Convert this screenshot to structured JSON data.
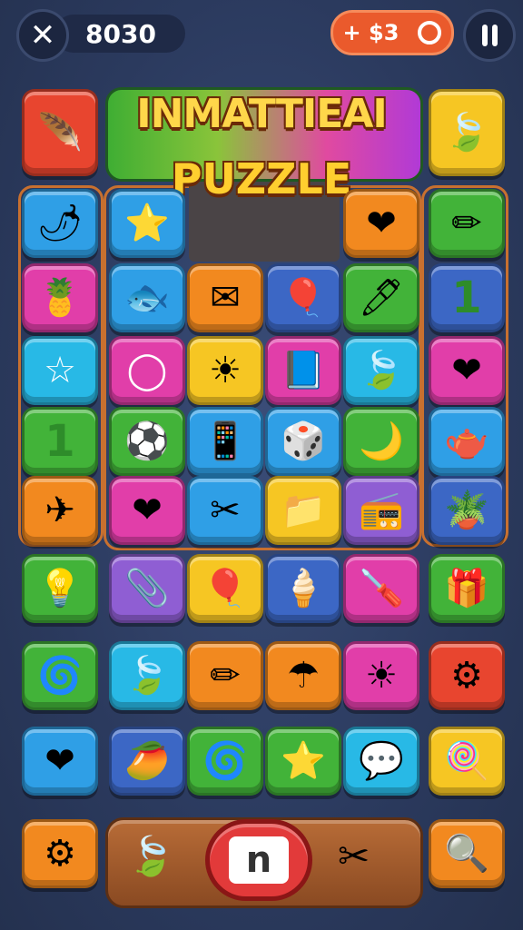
{
  "topbar": {
    "close_icon": "✕",
    "score": "8030",
    "coins_label": "+ $3",
    "coin_icon": "ring-icon",
    "pause_icon": "pause-icon"
  },
  "title": {
    "line1": "INMATTIEAI",
    "line2": "PUZZLE"
  },
  "colors": {
    "red": "#e8452f",
    "orange": "#f2891f",
    "yellow": "#f6c623",
    "green": "#42b339",
    "blue": "#2f9fe6",
    "navy": "#3c67c5",
    "pink": "#e13ea9",
    "purple": "#8f5ed3",
    "cyan": "#28b9e6"
  },
  "tiles": [
    {
      "c": "red",
      "i": "🪶"
    },
    {
      "c": "yellow",
      "i": "🍃"
    },
    {
      "c": "blue",
      "i": "🌶"
    },
    {
      "c": "blue",
      "i": "⭐"
    },
    {
      "c": "orange",
      "i": "❤"
    },
    {
      "c": "green",
      "i": "✏"
    },
    {
      "c": "pink",
      "i": "🍍"
    },
    {
      "c": "blue",
      "i": "🐟"
    },
    {
      "c": "orange",
      "i": "✉"
    },
    {
      "c": "navy",
      "i": "🎈"
    },
    {
      "c": "green",
      "i": "🖊"
    },
    {
      "c": "navy",
      "i": "1"
    },
    {
      "c": "cyan",
      "i": "☆"
    },
    {
      "c": "pink",
      "i": "◯"
    },
    {
      "c": "yellow",
      "i": "☀"
    },
    {
      "c": "pink",
      "i": "📘"
    },
    {
      "c": "cyan",
      "i": "🍃"
    },
    {
      "c": "pink",
      "i": "❤"
    },
    {
      "c": "green",
      "i": "1"
    },
    {
      "c": "green",
      "i": "⚽"
    },
    {
      "c": "blue",
      "i": "📱"
    },
    {
      "c": "blue",
      "i": "🎲"
    },
    {
      "c": "green",
      "i": "🌙"
    },
    {
      "c": "blue",
      "i": "🫖"
    },
    {
      "c": "orange",
      "i": "✈"
    },
    {
      "c": "pink",
      "i": "❤"
    },
    {
      "c": "blue",
      "i": "✂"
    },
    {
      "c": "yellow",
      "i": "📁"
    },
    {
      "c": "purple",
      "i": "📻"
    },
    {
      "c": "navy",
      "i": "🪴"
    },
    {
      "c": "green",
      "i": "💡"
    },
    {
      "c": "purple",
      "i": "📎"
    },
    {
      "c": "yellow",
      "i": "🎈"
    },
    {
      "c": "navy",
      "i": "🍦"
    },
    {
      "c": "pink",
      "i": "🪛"
    },
    {
      "c": "green",
      "i": "🎁"
    },
    {
      "c": "green",
      "i": "🌀"
    },
    {
      "c": "cyan",
      "i": "🍃"
    },
    {
      "c": "orange",
      "i": "✏"
    },
    {
      "c": "orange",
      "i": "☂"
    },
    {
      "c": "pink",
      "i": "☀"
    },
    {
      "c": "red",
      "i": "⚙"
    },
    {
      "c": "blue",
      "i": "❤"
    },
    {
      "c": "navy",
      "i": "🥭"
    },
    {
      "c": "green",
      "i": "🌀"
    },
    {
      "c": "green",
      "i": "⭐"
    },
    {
      "c": "cyan",
      "i": "💬"
    },
    {
      "c": "yellow",
      "i": "🍭"
    },
    {
      "c": "orange",
      "i": "⚙"
    },
    {
      "c": "orange",
      "i": "🔍"
    }
  ],
  "bottombar": {
    "left_icon": "🍃",
    "center_label": "n",
    "right_icon": "✂"
  }
}
